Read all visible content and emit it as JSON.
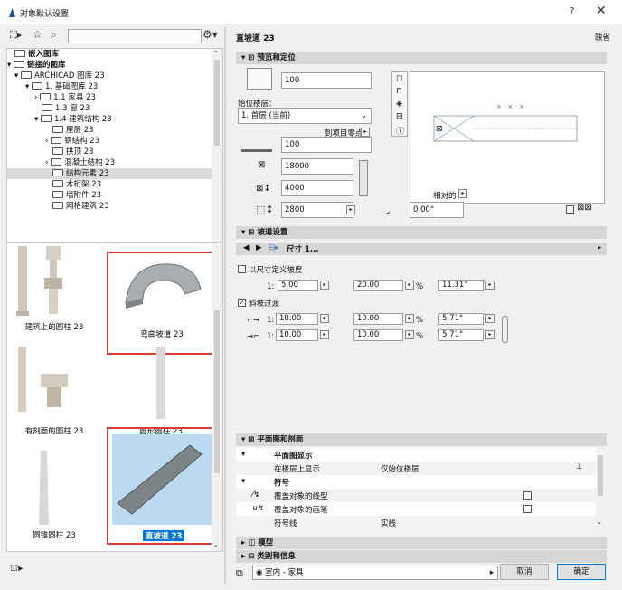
{
  "window": {
    "title": "对象默认设置",
    "help": "?",
    "close": "✕"
  },
  "left": {
    "tree": [
      "嵌入图库",
      "链接的图库",
      "ARCHICAD 图库 23",
      "1. 基础图库 23",
      "1.1 家具 23",
      "1.3 窗 23",
      "1.4 建筑结构 23",
      "屋层 23",
      "钢结构 23",
      "拱顶 23",
      "混凝土结构 23",
      "结构元素 23",
      "木桁架 23",
      "墙附件 23",
      "网格建筑 23"
    ],
    "gallery": [
      "建筑上的圆柱 23",
      "弯曲坡道 23",
      "有刻面的圆柱 23",
      "圆形圆柱 23",
      "圆锥圆柱 23",
      "直坡道 23"
    ]
  },
  "right": {
    "title": "直坡道 23",
    "default_label": "缺省",
    "sections": {
      "preview": "预览和定位",
      "ramp": "坡道设置",
      "floor_plan": "平面图和剖面",
      "model": "模型",
      "category": "类别和信息"
    },
    "preview": {
      "height": "100",
      "home_story_label": "始位楼层：",
      "home_story": "1. 首层 (当前)",
      "ref_label": "到项目零点",
      "offset": "100",
      "length": "18000",
      "width": "4000",
      "depth": "2800",
      "relative_label": "相对的",
      "angle": "0.00°"
    },
    "ramp": {
      "nav_label": "尺寸 1...",
      "custom_slope": "以尺寸定义坡度",
      "ratio_prefix": "1:",
      "slope_ratio": "5.00",
      "slope_pct": "20.00",
      "pct_unit": "%",
      "slope_deg": "11.31°",
      "transition_label": "斜坡过渡",
      "t1_ratio": "10.00",
      "t1_pct": "10.00",
      "t1_deg": "5.71°",
      "t2_ratio": "10.00",
      "t2_pct": "10.00",
      "t2_deg": "5.71°"
    },
    "floorplan": {
      "group1": "平面图显示",
      "row1_label": "在楼层上显示",
      "row1_value": "仅始位楼层",
      "group2": "符号",
      "row2_label": "覆盖对象的线型",
      "row3_label": "覆盖对象的画笔",
      "row4_label": "符号线",
      "row4_value": "实线"
    },
    "bottom": {
      "layer": "室内 - 家具",
      "cancel": "取消",
      "ok": "确定"
    }
  }
}
